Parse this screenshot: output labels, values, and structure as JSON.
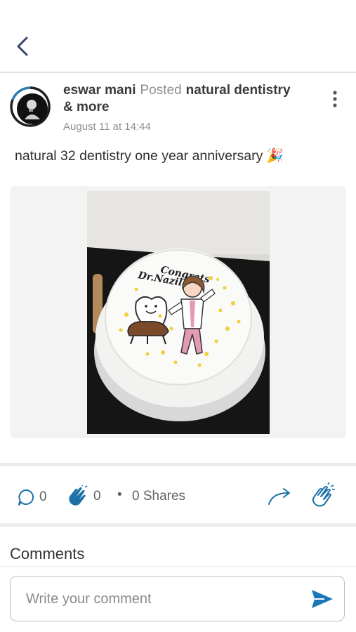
{
  "post": {
    "author": "eswar mani",
    "action": "Posted",
    "group": "natural dentistry",
    "group_suffix": "& more",
    "time": "August 11 at 14:44",
    "text": "natural 32 dentistry one year anniversary 🎉",
    "image_caption": [
      "Congrats",
      "Dr.Nazila"
    ]
  },
  "actions": {
    "comments_count": "0",
    "claps_count": "0",
    "bullet": "•",
    "shares_label": "0 Shares"
  },
  "comments": {
    "heading": "Comments",
    "input_placeholder": "Write your comment"
  },
  "colors": {
    "accent": "#1c72a8",
    "back_icon": "#36466b",
    "send": "#1b77b8"
  },
  "icons": {
    "back": "chevron-left-icon",
    "more": "more-vertical-icon",
    "comment": "comment-bubble-icon",
    "clap": "clap-icon",
    "share": "share-arrow-icon",
    "send": "send-icon"
  }
}
